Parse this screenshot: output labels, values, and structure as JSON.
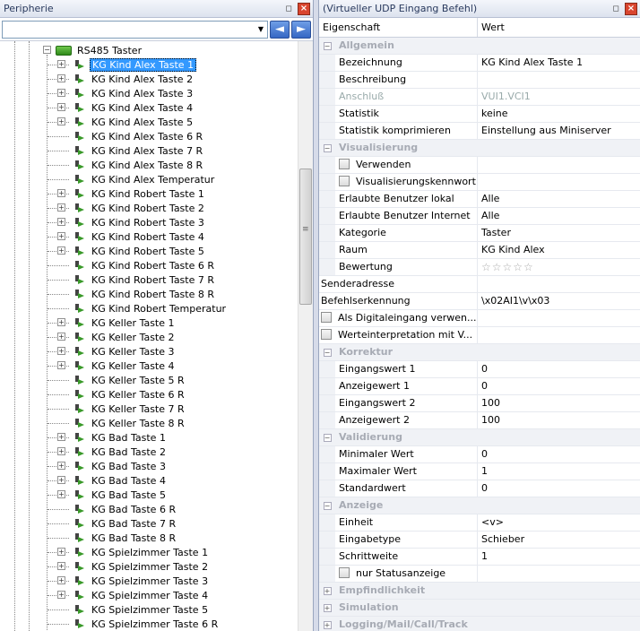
{
  "left_panel": {
    "title": "Peripherie",
    "combo_value": "",
    "root_label": "RS485 Taster",
    "items": [
      {
        "label": "KG Kind Alex Taste 1",
        "expandable": true,
        "selected": true
      },
      {
        "label": "KG Kind Alex Taste 2",
        "expandable": true
      },
      {
        "label": "KG Kind Alex Taste 3",
        "expandable": true
      },
      {
        "label": "KG Kind Alex Taste 4",
        "expandable": true
      },
      {
        "label": "KG Kind Alex Taste 5",
        "expandable": true
      },
      {
        "label": "KG Kind Alex Taste 6 R",
        "expandable": false
      },
      {
        "label": "KG Kind Alex Taste 7 R",
        "expandable": false
      },
      {
        "label": "KG Kind Alex Taste 8 R",
        "expandable": false
      },
      {
        "label": "KG Kind Alex Temperatur",
        "expandable": false
      },
      {
        "label": "KG Kind Robert Taste 1",
        "expandable": true
      },
      {
        "label": "KG Kind Robert Taste 2",
        "expandable": true
      },
      {
        "label": "KG Kind Robert Taste 3",
        "expandable": true
      },
      {
        "label": "KG Kind Robert Taste 4",
        "expandable": true
      },
      {
        "label": "KG Kind Robert Taste 5",
        "expandable": true
      },
      {
        "label": "KG Kind Robert Taste 6 R",
        "expandable": false
      },
      {
        "label": "KG Kind Robert Taste 7 R",
        "expandable": false
      },
      {
        "label": "KG Kind Robert Taste 8 R",
        "expandable": false
      },
      {
        "label": "KG Kind Robert Temperatur",
        "expandable": false
      },
      {
        "label": "KG Keller Taste 1",
        "expandable": true
      },
      {
        "label": "KG Keller Taste 2",
        "expandable": true
      },
      {
        "label": "KG Keller Taste 3",
        "expandable": true
      },
      {
        "label": "KG Keller Taste 4",
        "expandable": true
      },
      {
        "label": "KG Keller Taste 5 R",
        "expandable": false
      },
      {
        "label": "KG Keller Taste 6 R",
        "expandable": false
      },
      {
        "label": "KG Keller Taste 7 R",
        "expandable": false
      },
      {
        "label": "KG Keller Taste 8 R",
        "expandable": false
      },
      {
        "label": "KG Bad Taste 1",
        "expandable": true
      },
      {
        "label": "KG Bad Taste 2",
        "expandable": true
      },
      {
        "label": "KG Bad Taste 3",
        "expandable": true
      },
      {
        "label": "KG Bad Taste 4",
        "expandable": true
      },
      {
        "label": "KG Bad Taste 5",
        "expandable": true
      },
      {
        "label": "KG Bad Taste 6 R",
        "expandable": false
      },
      {
        "label": "KG Bad Taste 7 R",
        "expandable": false
      },
      {
        "label": "KG Bad Taste 8 R",
        "expandable": false
      },
      {
        "label": "KG Spielzimmer Taste 1",
        "expandable": true
      },
      {
        "label": "KG Spielzimmer Taste 2",
        "expandable": true
      },
      {
        "label": "KG Spielzimmer Taste 3",
        "expandable": true
      },
      {
        "label": "KG Spielzimmer Taste 4",
        "expandable": true
      },
      {
        "label": "KG Spielzimmer Taste 5",
        "expandable": false
      },
      {
        "label": "KG Spielzimmer Taste 6 R",
        "expandable": false
      }
    ]
  },
  "right_panel": {
    "title": "(Virtueller UDP Eingang Befehl)",
    "col_property": "Eigenschaft",
    "col_value": "Wert",
    "rows": [
      {
        "kind": "cat",
        "name": "Allgemein",
        "expanded": true
      },
      {
        "kind": "prop",
        "name": "Bezeichnung",
        "value": "KG Kind Alex Taste 1"
      },
      {
        "kind": "prop",
        "name": "Beschreibung",
        "value": ""
      },
      {
        "kind": "prop",
        "name": "Anschluß",
        "value": "VUI1.VCI1",
        "disabled": true
      },
      {
        "kind": "prop",
        "name": "Statistik",
        "value": "keine"
      },
      {
        "kind": "prop",
        "name": "Statistik komprimieren",
        "value": "Einstellung aus Miniserver"
      },
      {
        "kind": "cat",
        "name": "Visualisierung",
        "expanded": true
      },
      {
        "kind": "check",
        "name": "Verwenden",
        "value": ""
      },
      {
        "kind": "check",
        "name": "Visualisierungskennwort",
        "value": ""
      },
      {
        "kind": "prop",
        "name": "Erlaubte Benutzer lokal",
        "value": "Alle"
      },
      {
        "kind": "prop",
        "name": "Erlaubte Benutzer Internet",
        "value": "Alle"
      },
      {
        "kind": "prop",
        "name": "Kategorie",
        "value": "Taster"
      },
      {
        "kind": "prop",
        "name": "Raum",
        "value": "KG Kind Alex"
      },
      {
        "kind": "rating",
        "name": "Bewertung",
        "value": "☆☆☆☆☆",
        "rating": 0
      },
      {
        "kind": "top",
        "name": "Senderadresse",
        "value": ""
      },
      {
        "kind": "top",
        "name": "Befehlserkennung",
        "value": "\\x02AI1\\v\\x03"
      },
      {
        "kind": "topcheck",
        "name": "Als Digitaleingang verwen...",
        "value": ""
      },
      {
        "kind": "topcheck",
        "name": "Werteinterpretation mit V...",
        "value": ""
      },
      {
        "kind": "cat",
        "name": "Korrektur",
        "expanded": true
      },
      {
        "kind": "prop",
        "name": "Eingangswert 1",
        "value": "0"
      },
      {
        "kind": "prop",
        "name": "Anzeigewert 1",
        "value": "0"
      },
      {
        "kind": "prop",
        "name": "Eingangswert 2",
        "value": "100"
      },
      {
        "kind": "prop",
        "name": "Anzeigewert 2",
        "value": "100"
      },
      {
        "kind": "cat",
        "name": "Validierung",
        "expanded": true
      },
      {
        "kind": "prop",
        "name": "Minimaler Wert",
        "value": "0"
      },
      {
        "kind": "prop",
        "name": "Maximaler Wert",
        "value": "1"
      },
      {
        "kind": "prop",
        "name": "Standardwert",
        "value": "0"
      },
      {
        "kind": "cat",
        "name": "Anzeige",
        "expanded": true
      },
      {
        "kind": "prop",
        "name": "Einheit",
        "value": "<v>"
      },
      {
        "kind": "prop",
        "name": "Eingabetype",
        "value": "Schieber"
      },
      {
        "kind": "prop",
        "name": "Schrittweite",
        "value": "1"
      },
      {
        "kind": "check",
        "name": "nur Statusanzeige",
        "value": ""
      },
      {
        "kind": "cat",
        "name": "Empfindlichkeit",
        "expanded": false
      },
      {
        "kind": "cat",
        "name": "Simulation",
        "expanded": false
      },
      {
        "kind": "cat",
        "name": "Logging/Mail/Call/Track",
        "expanded": false
      }
    ]
  },
  "icons": {
    "pin": "pin-icon",
    "close": "close-icon",
    "back": "back-arrow-icon",
    "forward": "forward-arrow-icon",
    "dropdown": "chevron-down-icon"
  },
  "colors": {
    "selection": "#3399ff",
    "category_text": "#a7abb4",
    "title_text": "#2a3a5e"
  }
}
